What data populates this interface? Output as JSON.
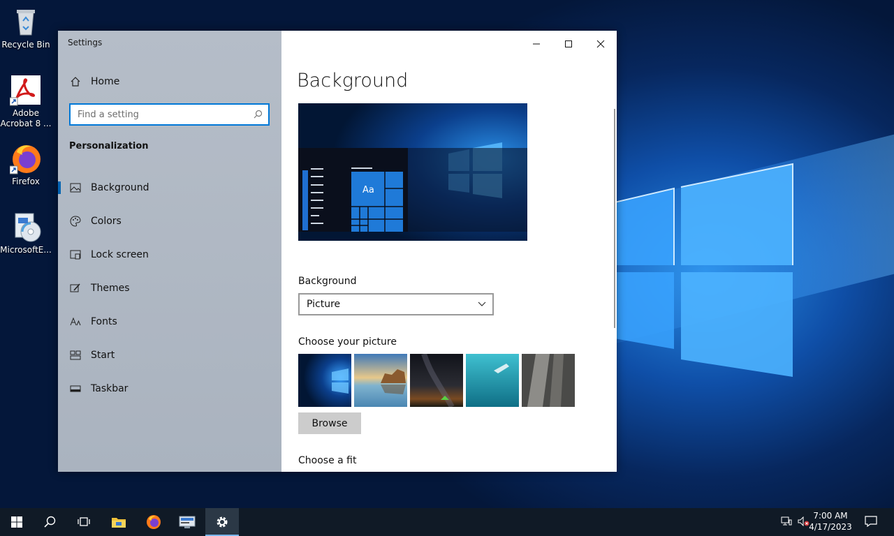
{
  "desktop": {
    "icons": [
      {
        "label": "Recycle Bin"
      },
      {
        "label": "Adobe Acrobat 8 ..."
      },
      {
        "label": "Firefox"
      },
      {
        "label": "MicrosoftE..."
      }
    ]
  },
  "window": {
    "title": "Settings",
    "controls": {
      "minimize": "—",
      "maximize": "☐",
      "close": "✕"
    }
  },
  "sidebar": {
    "home_label": "Home",
    "search_placeholder": "Find a setting",
    "section_title": "Personalization",
    "items": [
      {
        "label": "Background",
        "icon": "picture-icon",
        "active": true
      },
      {
        "label": "Colors",
        "icon": "palette-icon",
        "active": false
      },
      {
        "label": "Lock screen",
        "icon": "lock-screen-icon",
        "active": false
      },
      {
        "label": "Themes",
        "icon": "brush-icon",
        "active": false
      },
      {
        "label": "Fonts",
        "icon": "font-icon",
        "active": false
      },
      {
        "label": "Start",
        "icon": "start-icon",
        "active": false
      },
      {
        "label": "Taskbar",
        "icon": "taskbar-icon",
        "active": false
      }
    ]
  },
  "main": {
    "title": "Background",
    "preview_tile_text": "Aa",
    "background_label": "Background",
    "background_value": "Picture",
    "choose_picture_label": "Choose your picture",
    "browse_label": "Browse",
    "choose_fit_label": "Choose a fit"
  },
  "taskbar": {
    "time": "7:00 AM",
    "date": "4/17/2023"
  },
  "colors": {
    "accent": "#0078d7",
    "taskbar": "#101a26",
    "sidebar": "#b6bec9"
  }
}
